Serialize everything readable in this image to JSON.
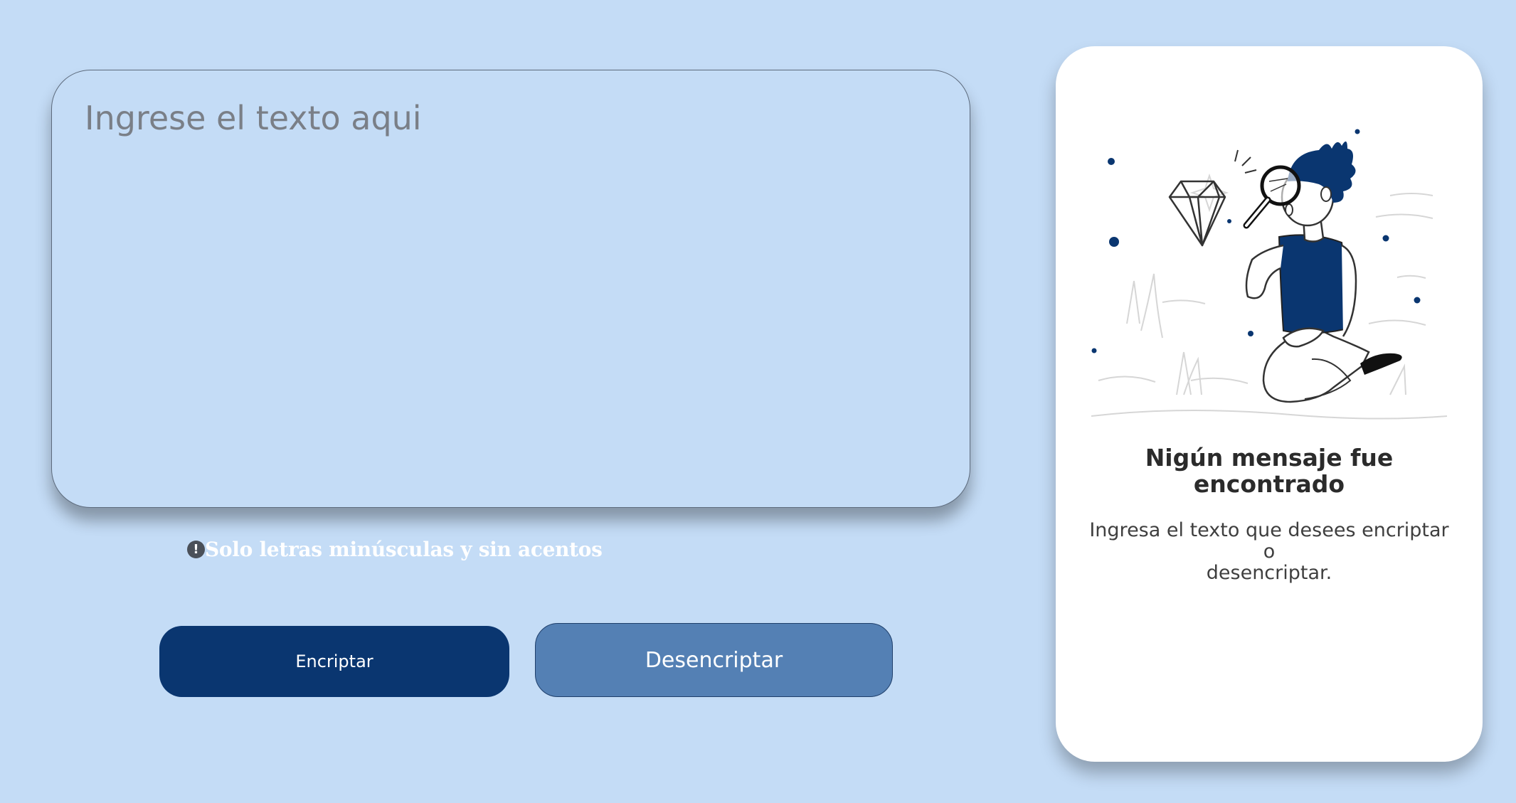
{
  "input": {
    "placeholder": "Ingrese el texto aqui",
    "value": ""
  },
  "hint": {
    "icon_glyph": "!",
    "text": "Solo letras minúsculas y sin acentos"
  },
  "buttons": {
    "encrypt_label": "Encriptar",
    "decrypt_label": "Desencriptar"
  },
  "result": {
    "title_line1": "Nigún mensaje fue",
    "title_line2": "encontrado",
    "desc_line1": "Ingresa el texto que desees encriptar",
    "desc_line2": "o",
    "desc_line3": "desencriptar.",
    "illustration_icon": "person-with-magnifying-glass-and-diamond"
  },
  "colors": {
    "background": "#c4dcf6",
    "primary": "#0a3670",
    "secondary": "#5480b4",
    "card": "#ffffff"
  }
}
